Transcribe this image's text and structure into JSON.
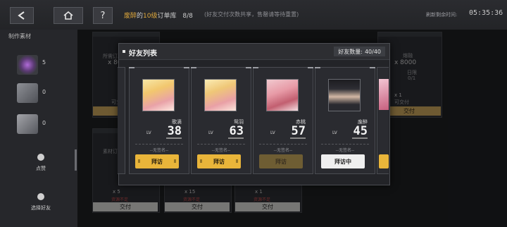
{
  "topbar": {
    "back_icon": "back-arrow-icon",
    "home_icon": "home-icon",
    "help_icon": "help-icon",
    "help_label": "?",
    "order_owner": "废醉",
    "order_of": "的",
    "order_level": "10级",
    "order_title": "订单库",
    "order_progress": "8/8",
    "order_note": "(好友交付次数共享，售罄请等待重置)",
    "refresh_label": "刷新剩余时间:",
    "refresh_time": "05:35:36"
  },
  "sidebar": {
    "title": "制作素材",
    "materials": [
      {
        "icon": "purple-orb-material-icon",
        "count": "5"
      },
      {
        "icon": "book-material-icon",
        "count": "0"
      },
      {
        "icon": "cube-material-icon",
        "count": "0"
      }
    ],
    "like_label": "点赞",
    "select_friend_label": "选择好友"
  },
  "background_cards": {
    "card1_label": "所需订单",
    "card1_qty": "x 80",
    "card1_deliverable": "可交付",
    "card6_label": "熔融",
    "card6_sub": "所需订单",
    "card6_qty": "x 8000",
    "card6_daily": "日限",
    "card6_daily_value": "0/1",
    "card5_qty": "x 1",
    "card5_deliverable": "可交付",
    "deliver_label": "交付",
    "bottom": [
      {
        "qty": "x 5",
        "warn": "资源不足",
        "button": "交付"
      },
      {
        "qty": "x 15",
        "warn": "资源不足",
        "button": "交付"
      },
      {
        "qty": "x 1",
        "warn": "资源不足",
        "button": "交付"
      }
    ],
    "left_mid_label": "素材订"
  },
  "friend_modal": {
    "title": "好友列表",
    "count_label": "好友数量:",
    "count_value": "40/40",
    "friends": [
      {
        "name": "歌滴",
        "lv": "LV",
        "level": "38",
        "sign": "--无签名--",
        "button": "拜访",
        "state": "active"
      },
      {
        "name": "鸳羽",
        "lv": "LV",
        "level": "63",
        "sign": "--无签名--",
        "button": "拜访",
        "state": "active"
      },
      {
        "name": "赤桃",
        "lv": "LV",
        "level": "57",
        "sign": "--无签名--",
        "button": "拜访",
        "state": "disabled"
      },
      {
        "name": "废醉",
        "lv": "LV",
        "level": "45",
        "sign": "--无签名--",
        "button": "拜访中",
        "state": "going"
      }
    ]
  },
  "colors": {
    "accent_gold": "#e9b53a",
    "highlight_name": "#e0a93c",
    "warning_red": "#c24b4b"
  }
}
